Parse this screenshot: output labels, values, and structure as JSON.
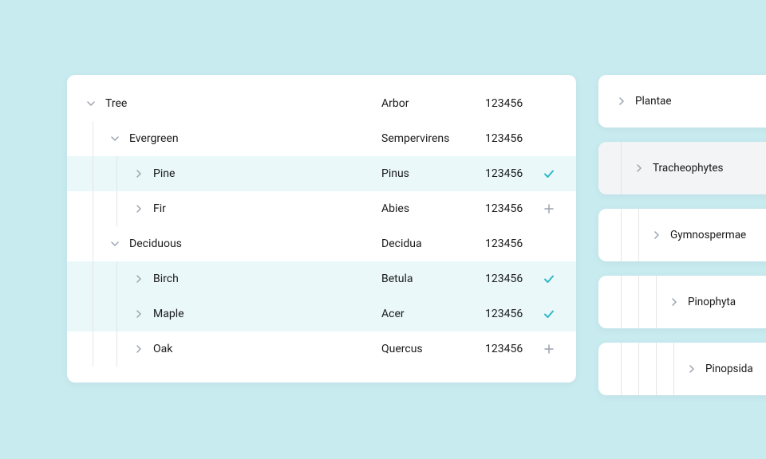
{
  "tree": [
    {
      "depth": 0,
      "expanded": true,
      "name": "Tree",
      "latin": "Arbor",
      "num": "123456",
      "action": null,
      "highlight": false
    },
    {
      "depth": 1,
      "expanded": true,
      "name": "Evergreen",
      "latin": "Sempervirens",
      "num": "123456",
      "action": null,
      "highlight": false
    },
    {
      "depth": 2,
      "expanded": false,
      "name": "Pine",
      "latin": "Pinus",
      "num": "123456",
      "action": "check",
      "highlight": true
    },
    {
      "depth": 2,
      "expanded": false,
      "name": "Fir",
      "latin": "Abies",
      "num": "123456",
      "action": "plus",
      "highlight": false
    },
    {
      "depth": 1,
      "expanded": true,
      "name": "Deciduous",
      "latin": "Decidua",
      "num": "123456",
      "action": null,
      "highlight": false
    },
    {
      "depth": 2,
      "expanded": false,
      "name": "Birch",
      "latin": "Betula",
      "num": "123456",
      "action": "check",
      "highlight": true
    },
    {
      "depth": 2,
      "expanded": false,
      "name": "Maple",
      "latin": "Acer",
      "num": "123456",
      "action": "check",
      "highlight": true
    },
    {
      "depth": 2,
      "expanded": false,
      "name": "Oak",
      "latin": "Quercus",
      "num": "123456",
      "action": "plus",
      "highlight": false
    }
  ],
  "side": [
    {
      "depth": 0,
      "name": "Plantae",
      "selected": false
    },
    {
      "depth": 1,
      "name": "Tracheophytes",
      "selected": true
    },
    {
      "depth": 2,
      "name": "Gymnospermae",
      "selected": false
    },
    {
      "depth": 3,
      "name": "Pinophyta",
      "selected": false
    },
    {
      "depth": 4,
      "name": "Pinopsida",
      "selected": false
    }
  ]
}
